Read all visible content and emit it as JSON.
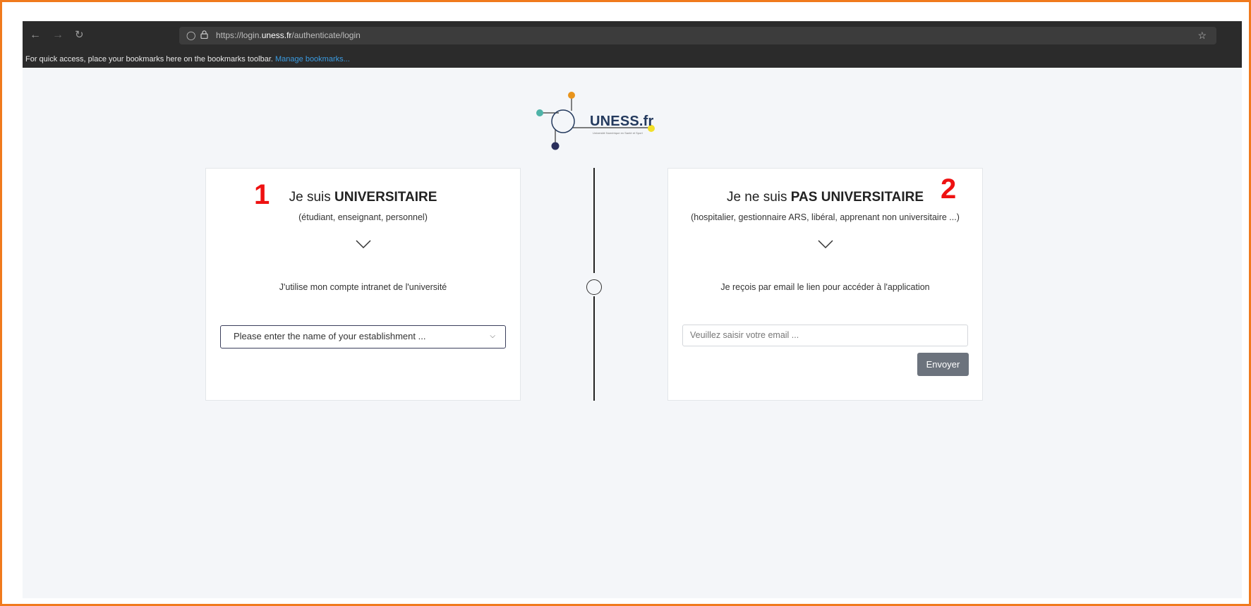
{
  "browser": {
    "nav_back_icon": "arrow-left-icon",
    "nav_forward_icon": "arrow-right-icon",
    "reload_icon": "reload-icon",
    "url_prefix": "https://login.",
    "url_domain": "uness.fr",
    "url_path": "/authenticate/login",
    "bookmarks_text": "For quick access, place your bookmarks here on the bookmarks toolbar.",
    "bookmarks_link": "Manage bookmarks..."
  },
  "logo": {
    "text": "UNESS.fr",
    "tagline": "Université Numérique en Santé et Sport"
  },
  "left_card": {
    "title_prefix": "Je suis ",
    "title_bold": "UNIVERSITAIRE",
    "subtitle": "(étudiant, enseignant, personnel)",
    "description": "J'utilise mon compte intranet de l'université",
    "select_placeholder": "Please enter the name of your establishment ..."
  },
  "right_card": {
    "title_prefix": "Je ne suis ",
    "title_bold": "PAS UNIVERSITAIRE",
    "subtitle": "(hospitalier, gestionnaire ARS, libéral, apprenant non universitaire ...)",
    "description": "Je reçois par email le lien pour accéder à l'application",
    "email_placeholder": "Veuillez saisir votre email ...",
    "send_label": "Envoyer"
  },
  "annotations": {
    "marker_1": "1",
    "marker_2": "2"
  },
  "colors": {
    "annotation": "#ee1111",
    "frame_border": "#f07a1d",
    "logo_text": "#243a5e",
    "send_button": "#6c737d"
  }
}
